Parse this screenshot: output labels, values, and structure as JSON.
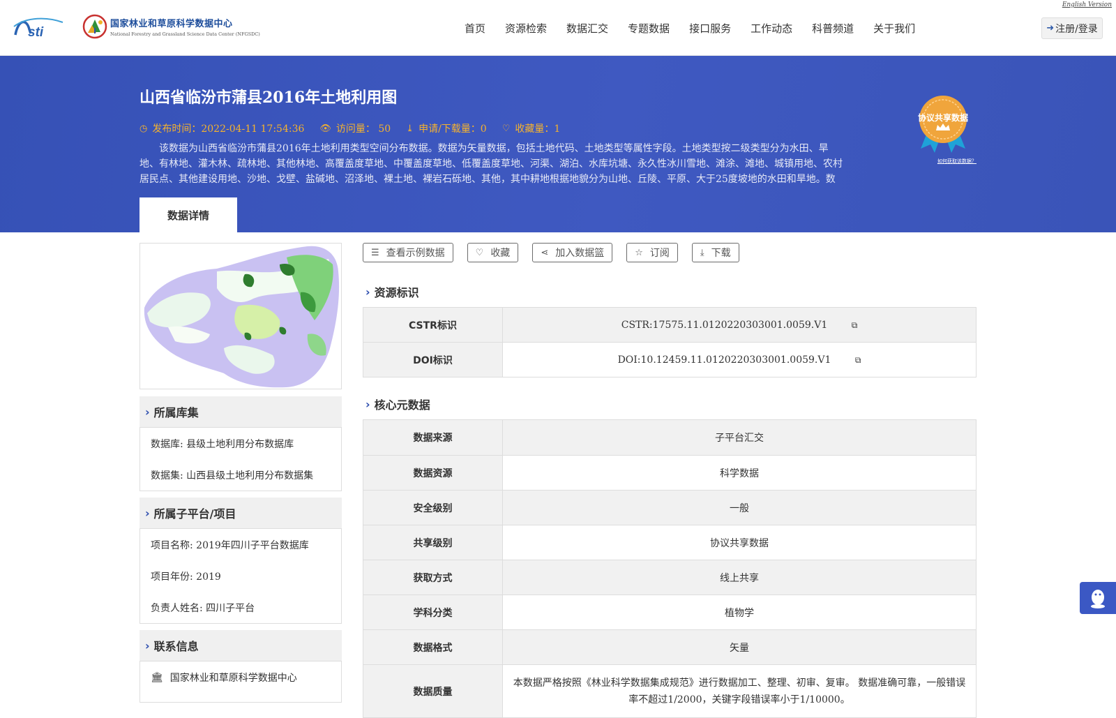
{
  "header": {
    "english_link": "English Version",
    "logo_nsti_text": "Nsti",
    "logo_cn": "国家林业和草原科学数据中心",
    "logo_en": "National Forestry and Grassland Science Data Center (NFGSDC)",
    "nav": [
      "首页",
      "资源检索",
      "数据汇交",
      "专题数据",
      "接口服务",
      "工作动态",
      "科普频道",
      "关于我们"
    ],
    "login_label": "注册/登录"
  },
  "banner": {
    "title": "山西省临汾市蒲县2016年土地利用图",
    "publish": "发布时间：2022-04-11 17:54:36",
    "views": "访问量： 50",
    "downloads": "申请/下载量：0",
    "favorites": "收藏量：1",
    "description": "该数据为山西省临汾市蒲县2016年土地利用类型空间分布数据。数据为矢量数据，包括土地代码、土地类型等属性字段。土地类型按二级类型分为水田、旱地、有林地、灌木林、疏林地、其他林地、高覆盖度草地、中覆盖度草地、低覆盖度草地、河渠、湖泊、水库坑塘、永久性冰川雪地、滩涂、滩地、城镇用地、农村居民点、其他建设用地、沙地、戈壁、盐碱地、沼泽地、裸土地、裸岩石砾地、其他，其中耕地根据地貌分为山地、丘陵、平原、大于25度坡地的水田和旱地。数据比…",
    "badge_text": "协议共享数据",
    "badge_link": "如何获取该数据？",
    "tab_label": "数据详情"
  },
  "actions": [
    "查看示例数据",
    "收藏",
    "加入数据篮",
    "订阅",
    "下载"
  ],
  "left": {
    "library_title": "所属库集",
    "library_rows": [
      "数据库: 县级土地利用分布数据库",
      "数据集: 山西县级土地利用分布数据集"
    ],
    "project_title": "所属子平台/项目",
    "project_rows": [
      "项目名称: 2019年四川子平台数据库",
      "项目年份: 2019",
      "负责人姓名: 四川子平台"
    ],
    "contact_title": "联系信息",
    "contact_org": "国家林业和草原科学数据中心"
  },
  "resource": {
    "title": "资源标识",
    "rows": [
      {
        "key": "CSTR标识",
        "value": "CSTR:17575.11.0120220303001.0059.V1"
      },
      {
        "key": "DOI标识",
        "value": "DOI:10.12459.11.0120220303001.0059.V1"
      }
    ]
  },
  "core": {
    "title": "核心元数据",
    "rows": [
      {
        "key": "数据来源",
        "value": "子平台汇交"
      },
      {
        "key": "数据资源",
        "value": "科学数据"
      },
      {
        "key": "安全级别",
        "value": "一般"
      },
      {
        "key": "共享级别",
        "value": "协议共享数据"
      },
      {
        "key": "获取方式",
        "value": "线上共享"
      },
      {
        "key": "学科分类",
        "value": "植物学"
      },
      {
        "key": "数据格式",
        "value": "矢量"
      },
      {
        "key": "数据质量",
        "value": "本数据严格按照《林业科学数据集成规范》进行数据加工、整理、初审、复审。 数据准确可靠，一般错误率不超过1/2000，关键字段错误率小于1/10000。"
      }
    ]
  },
  "colors": {
    "banner": "#3b54ba",
    "accent": "#f5b22e",
    "chevron": "#2b4cae"
  }
}
